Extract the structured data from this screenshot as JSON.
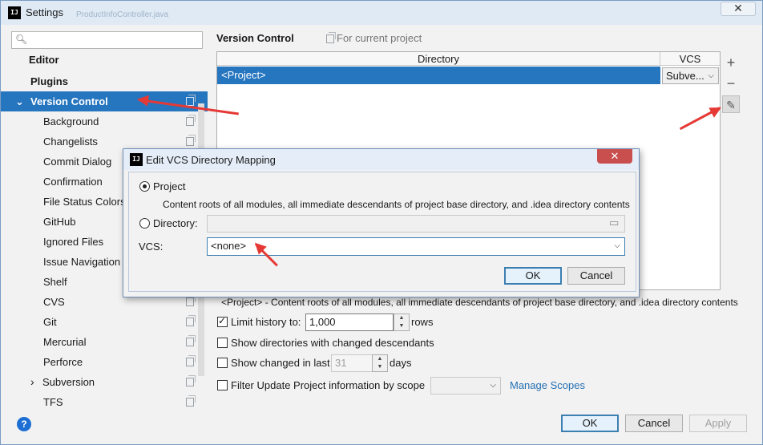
{
  "window": {
    "title": "Settings",
    "background_title_ghost": "ProductInfoController.java",
    "close_glyph": "✕"
  },
  "search": {
    "placeholder": ""
  },
  "sidebar": {
    "items": [
      {
        "label": "Editor"
      },
      {
        "label": "Plugins"
      },
      {
        "label": "Version Control"
      },
      {
        "label": "Background"
      },
      {
        "label": "Changelists"
      },
      {
        "label": "Commit Dialog"
      },
      {
        "label": "Confirmation"
      },
      {
        "label": "File Status Colors"
      },
      {
        "label": "GitHub"
      },
      {
        "label": "Ignored Files"
      },
      {
        "label": "Issue Navigation"
      },
      {
        "label": "Shelf"
      },
      {
        "label": "CVS"
      },
      {
        "label": "Git"
      },
      {
        "label": "Mercurial"
      },
      {
        "label": "Perforce"
      },
      {
        "label": "Subversion"
      },
      {
        "label": "TFS"
      }
    ]
  },
  "content": {
    "title": "Version Control",
    "scope": "For current project",
    "table": {
      "headers": [
        "Directory",
        "VCS"
      ],
      "rows": [
        {
          "directory": "<Project>",
          "vcs": "Subve..."
        }
      ]
    },
    "project_note": "<Project> - Content roots of all modules, all immediate descendants of project base directory, and .idea directory contents",
    "limit_history": {
      "label": "Limit history to:",
      "value": "1,000",
      "unit": "rows",
      "checked": true
    },
    "show_dirs": {
      "label": "Show directories with changed descendants",
      "checked": false
    },
    "show_changed": {
      "label": "Show changed in last",
      "value": "31",
      "unit": "days",
      "checked": false
    },
    "filter_update": {
      "label": "Filter Update Project information by scope",
      "checked": false
    },
    "manage_scopes": "Manage Scopes"
  },
  "footer": {
    "ok": "OK",
    "cancel": "Cancel",
    "apply": "Apply",
    "help": "?"
  },
  "dialog": {
    "title": "Edit VCS Directory Mapping",
    "project_option": "Project",
    "project_desc": "Content roots of all modules, all immediate descendants of project base directory, and .idea directory contents",
    "directory_option": "Directory:",
    "directory_value": "",
    "vcs_label": "VCS:",
    "vcs_value": "<none>",
    "ok": "OK",
    "cancel": "Cancel",
    "close_glyph": "✕"
  },
  "icons": {
    "app": "IJ",
    "add": "+",
    "remove": "−",
    "edit": "✎",
    "folder": "▭",
    "dropdown": "⌵",
    "expanded": "⌄",
    "collapsed": "›"
  },
  "colors": {
    "selection": "#2675bf",
    "arrow": "#e53935",
    "link": "#2470b3",
    "dialog_close": "#c94f4f"
  }
}
